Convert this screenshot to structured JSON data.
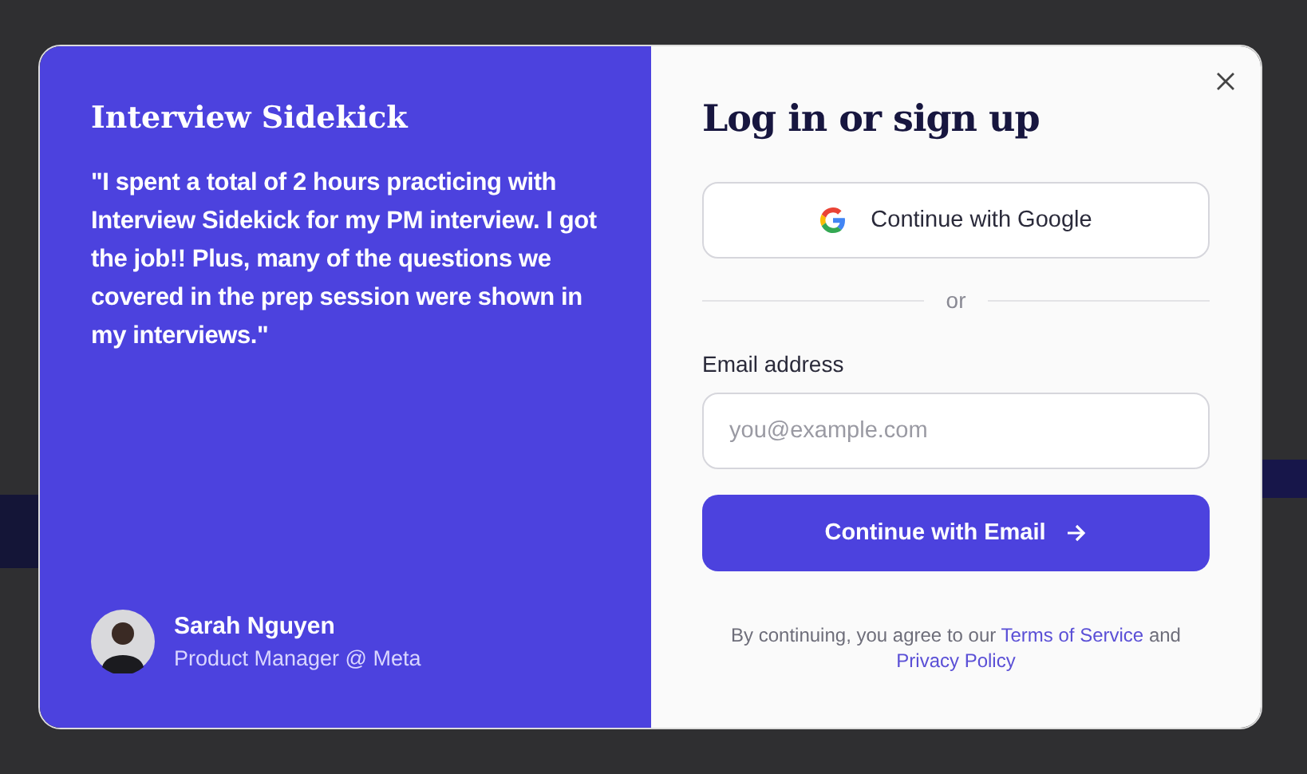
{
  "modal": {
    "brand": "Interview Sidekick",
    "quote": "\"I spent a total of 2 hours practicing with Interview Sidekick for my PM interview. I got the job!! Plus, many of the questions we covered in the prep session were shown in my interviews.\"",
    "author": {
      "name": "Sarah Nguyen",
      "role": "Product Manager @ Meta"
    },
    "title": "Log in or sign up",
    "google_button": "Continue with Google",
    "divider": "or",
    "email": {
      "label": "Email address",
      "placeholder": "you@example.com"
    },
    "email_button": "Continue with Email",
    "legal": {
      "text": "By continuing, you agree to our",
      "terms": "Terms of Service",
      "and": "and",
      "privacy": "Privacy Policy"
    }
  }
}
